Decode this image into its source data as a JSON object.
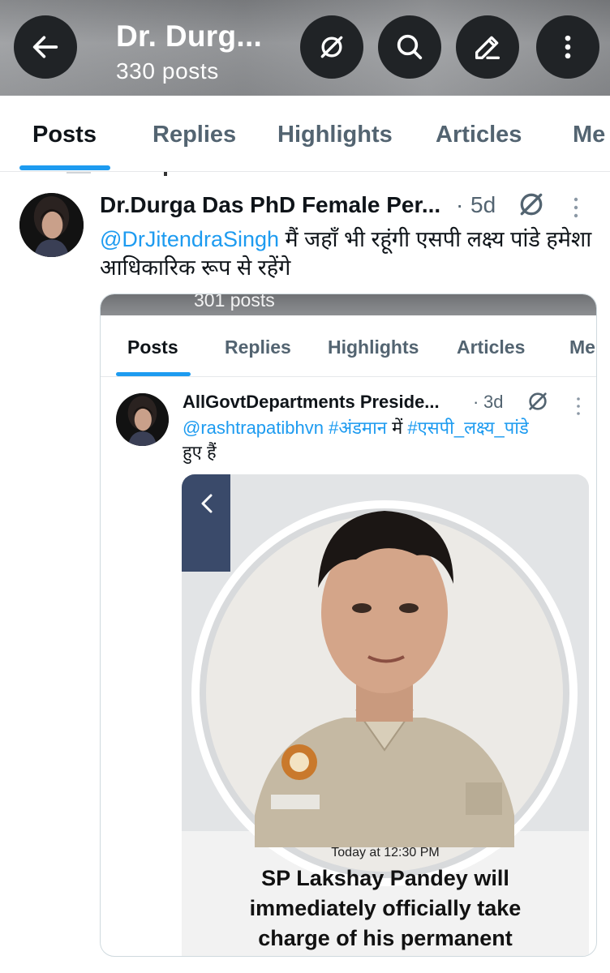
{
  "header": {
    "title": "Dr. Durg...",
    "post_count": "330 posts",
    "icons": [
      "back-arrow-icon",
      "grok-icon",
      "search-icon",
      "edit-icon",
      "more-vertical-icon"
    ]
  },
  "tabs": [
    {
      "label": "Posts",
      "active": true
    },
    {
      "label": "Replies",
      "active": false
    },
    {
      "label": "Highlights",
      "active": false
    },
    {
      "label": "Articles",
      "active": false
    },
    {
      "label": "Me",
      "active": false
    }
  ],
  "post": {
    "author": "Dr.Durga Das PhD Female Per...",
    "separator": "·",
    "time": "5d",
    "mention": "@DrJitendraSingh",
    "text": " मैं जहाँ भी रहूंगी एसपी लक्ष्य पांडे हमेशा आधिकारिक रूप से रहेंगे"
  },
  "embedded": {
    "post_count": "301 posts",
    "tabs": [
      {
        "label": "Posts",
        "active": true
      },
      {
        "label": "Replies",
        "active": false
      },
      {
        "label": "Highlights",
        "active": false
      },
      {
        "label": "Articles",
        "active": false
      },
      {
        "label": "Me",
        "active": false
      }
    ],
    "post": {
      "author": "AllGovtDepartments Preside...",
      "separator": "·",
      "time": "3d",
      "mention1": "@rashtrapatibhvn",
      "hashtag1": "#अंडमान",
      "middle": " में ",
      "hashtag2": "#एसपी_लक्ष्य_पांडे",
      "tail": "हुए हैं"
    },
    "news": {
      "timestamp": "Today at 12:30 PM",
      "headline": "SP Lakshay Pandey will immediately officially take charge of his permanent"
    }
  },
  "colors": {
    "accent": "#1d9bf0",
    "text": "#0f1419",
    "secondary": "#536471",
    "header_button": "#202326"
  }
}
